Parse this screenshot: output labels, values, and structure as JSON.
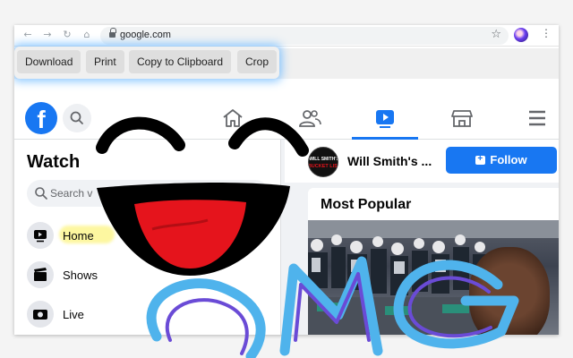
{
  "browser": {
    "url": "google.com"
  },
  "extension_toolbar": {
    "buttons": [
      "Download",
      "Print",
      "Copy to Clipboard",
      "Crop"
    ]
  },
  "facebook": {
    "sidebar": {
      "title": "Watch",
      "search_placeholder": "Search v",
      "items": [
        {
          "label": "Home",
          "icon": "tv-icon"
        },
        {
          "label": "Shows",
          "icon": "clapperboard-icon"
        },
        {
          "label": "Live",
          "icon": "live-camera-icon"
        }
      ]
    },
    "page": {
      "name": "Will Smith's ...",
      "follow_label": "Follow",
      "section_title": "Most Popular",
      "avatar_text": "WILL SMITH'S BUCKET LIST"
    }
  },
  "overlay": {
    "text": "OMG",
    "colors": {
      "smiley_stroke": "#000000",
      "tongue": "#e5141c",
      "omg_stroke": "#4fb3ec",
      "omg_inner": "#6a4bd6"
    }
  },
  "colors": {
    "fb_blue": "#1877f2",
    "glow": "#78beff"
  }
}
